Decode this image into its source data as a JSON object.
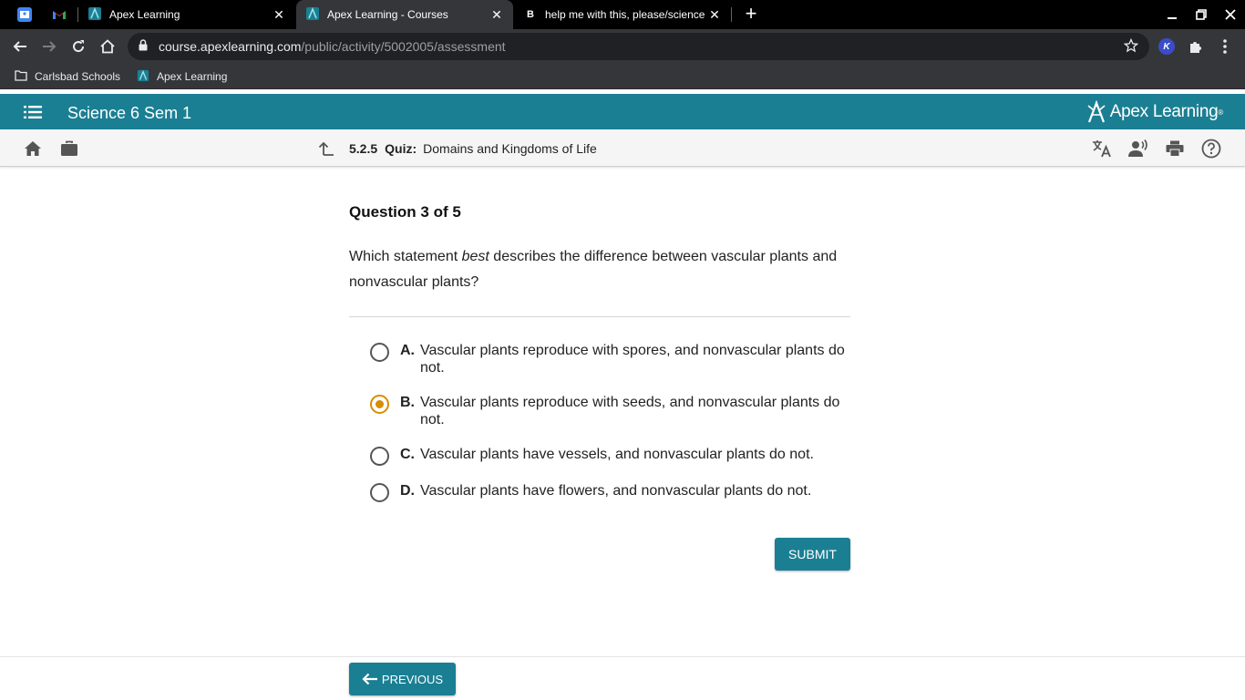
{
  "browser": {
    "tabs": [
      {
        "title": "Apex Learning",
        "icon": "apex-favicon"
      },
      {
        "title": "Apex Learning - Courses",
        "icon": "apex-favicon",
        "active": true
      },
      {
        "title": "help me with this, please/science",
        "icon": "brainly-favicon"
      }
    ],
    "url": {
      "host": "course.apexlearning.com",
      "path": "/public/activity/5002005/assessment"
    },
    "bookmarks": [
      {
        "label": "Carlsbad Schools",
        "icon": "folder-icon"
      },
      {
        "label": "Apex Learning",
        "icon": "apex-favicon"
      }
    ],
    "extension_label": "K"
  },
  "app": {
    "course_title": "Science 6 Sem 1",
    "brand": "Apex Learning",
    "brand_mark": "®",
    "breadcrumb": {
      "number": "5.2.5",
      "kind": "Quiz:",
      "name": "Domains and Kingdoms of Life"
    }
  },
  "quiz": {
    "header": "Question 3 of 5",
    "question_pre": "Which statement ",
    "question_em": "best",
    "question_post": " describes the difference between vascular plants and nonvascular plants?",
    "choices": [
      {
        "letter": "A.",
        "text": "Vascular plants reproduce with spores, and nonvascular plants do not.",
        "selected": false
      },
      {
        "letter": "B.",
        "text": "Vascular plants reproduce with seeds, and nonvascular plants do not.",
        "selected": true
      },
      {
        "letter": "C.",
        "text": "Vascular plants have vessels, and nonvascular plants do not.",
        "selected": false
      },
      {
        "letter": "D.",
        "text": "Vascular plants have flowers, and nonvascular plants do not.",
        "selected": false
      }
    ],
    "submit_label": "SUBMIT",
    "previous_label": "PREVIOUS"
  },
  "colors": {
    "accent": "#1b7f93",
    "selected": "#d98c00"
  }
}
